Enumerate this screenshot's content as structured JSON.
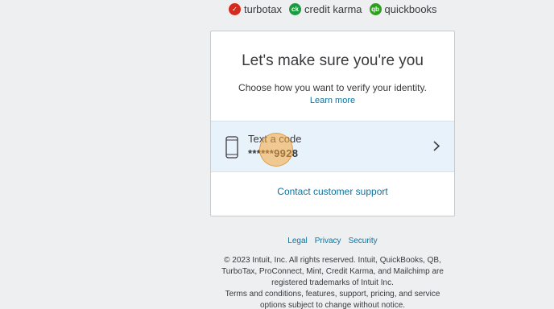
{
  "brands": [
    {
      "icon": "turbotax-check-icon",
      "glyph": "✓",
      "color": "#d52b1e",
      "label": "turbotax"
    },
    {
      "icon": "credit-karma-logo-icon",
      "glyph": "ck",
      "color": "#1a9c3e",
      "label": "credit karma"
    },
    {
      "icon": "quickbooks-logo-icon",
      "glyph": "qb",
      "color": "#2ca01c",
      "label": "quickbooks"
    }
  ],
  "card": {
    "title": "Let's make sure you're you",
    "subtitle": "Choose how you want to verify your identity.",
    "learn_more": "Learn more",
    "option": {
      "label": "Text a code",
      "number": "******9928"
    },
    "contact": "Contact customer support"
  },
  "footer": {
    "links": [
      "Legal",
      "Privacy",
      "Security"
    ],
    "copyright": "© 2023 Intuit, Inc. All rights reserved. Intuit, QuickBooks, QB, TurboTax, ProConnect, Mint, Credit Karma, and Mailchimp are registered trademarks of Intuit Inc.",
    "terms": "Terms and conditions, features, support, pricing, and service options subject to change without notice."
  },
  "colors": {
    "link": "#0d72a0",
    "option_bg": "#e8f2fa",
    "page_bg": "#eeeff1"
  }
}
